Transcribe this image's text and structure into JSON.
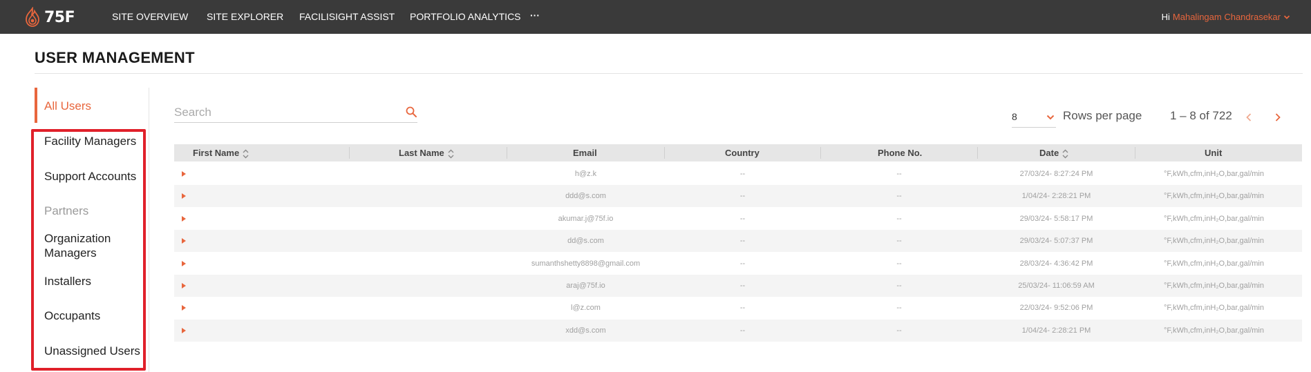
{
  "header": {
    "logo_text": "75F",
    "nav": [
      {
        "label": "SITE OVERVIEW"
      },
      {
        "label": "SITE EXPLORER"
      },
      {
        "label": "FACILISIGHT ASSIST"
      },
      {
        "label": "PORTFOLIO ANALYTICS"
      }
    ],
    "more_label": "···",
    "greeting": "Hi",
    "user_name": "Mahalingam Chandrasekar"
  },
  "page": {
    "title": "USER MANAGEMENT"
  },
  "sidebar": {
    "items": [
      {
        "label": "All Users",
        "state": "active"
      },
      {
        "label": "Facility Managers"
      },
      {
        "label": "Support Accounts"
      },
      {
        "label": "Partners",
        "state": "muted"
      },
      {
        "label": "Organization Managers"
      },
      {
        "label": "Installers"
      },
      {
        "label": "Occupants"
      },
      {
        "label": "Unassigned Users"
      }
    ]
  },
  "search": {
    "placeholder": "Search",
    "value": ""
  },
  "pagination": {
    "rows_per_page": "8",
    "rows_per_page_label": "Rows per page",
    "range": "1 – 8 of 722"
  },
  "table": {
    "columns": [
      "First Name",
      "Last Name",
      "Email",
      "Country",
      "Phone No.",
      "Date",
      "Unit"
    ],
    "rows": [
      {
        "first_name": "",
        "last_name": "",
        "email": "h@z.k",
        "country": "--",
        "phone": "--",
        "date": "27/03/24- 8:27:24 PM",
        "unit": "°F,kWh,cfm,inH₂O,bar,gal/min"
      },
      {
        "first_name": "",
        "last_name": "",
        "email": "ddd@s.com",
        "country": "--",
        "phone": "--",
        "date": "1/04/24- 2:28:21 PM",
        "unit": "°F,kWh,cfm,inH₂O,bar,gal/min"
      },
      {
        "first_name": "",
        "last_name": "",
        "email": "akumar.j@75f.io",
        "country": "--",
        "phone": "--",
        "date": "29/03/24- 5:58:17 PM",
        "unit": "°F,kWh,cfm,inH₂O,bar,gal/min"
      },
      {
        "first_name": "",
        "last_name": "",
        "email": "dd@s.com",
        "country": "--",
        "phone": "--",
        "date": "29/03/24- 5:07:37 PM",
        "unit": "°F,kWh,cfm,inH₂O,bar,gal/min"
      },
      {
        "first_name": "",
        "last_name": "",
        "email": "sumanthshetty8898@gmail.com",
        "country": "--",
        "phone": "--",
        "date": "28/03/24- 4:36:42 PM",
        "unit": "°F,kWh,cfm,inH₂O,bar,gal/min"
      },
      {
        "first_name": "",
        "last_name": "",
        "email": "araj@75f.io",
        "country": "--",
        "phone": "--",
        "date": "25/03/24- 11:06:59 AM",
        "unit": "°F,kWh,cfm,inH₂O,bar,gal/min"
      },
      {
        "first_name": "",
        "last_name": "",
        "email": "l@z.com",
        "country": "--",
        "phone": "--",
        "date": "22/03/24- 9:52:06 PM",
        "unit": "°F,kWh,cfm,inH₂O,bar,gal/min"
      },
      {
        "first_name": "",
        "last_name": "",
        "email": "xdd@s.com",
        "country": "--",
        "phone": "--",
        "date": "1/04/24- 2:28:21 PM",
        "unit": "°F,kWh,cfm,inH₂O,bar,gal/min"
      }
    ]
  },
  "colors": {
    "accent": "#e8663d",
    "topbar": "#3a3a3a",
    "highlight": "#e0202a",
    "header_row": "#e6e6e6",
    "alt_row": "#f4f4f4"
  },
  "icons": {
    "logo": "flame-logo-icon",
    "user_menu": "chevron-down-icon",
    "search": "search-icon",
    "sort": "sort-icon",
    "row_expand": "caret-right-icon",
    "prev": "chevron-left-icon",
    "next": "chevron-right-icon"
  }
}
